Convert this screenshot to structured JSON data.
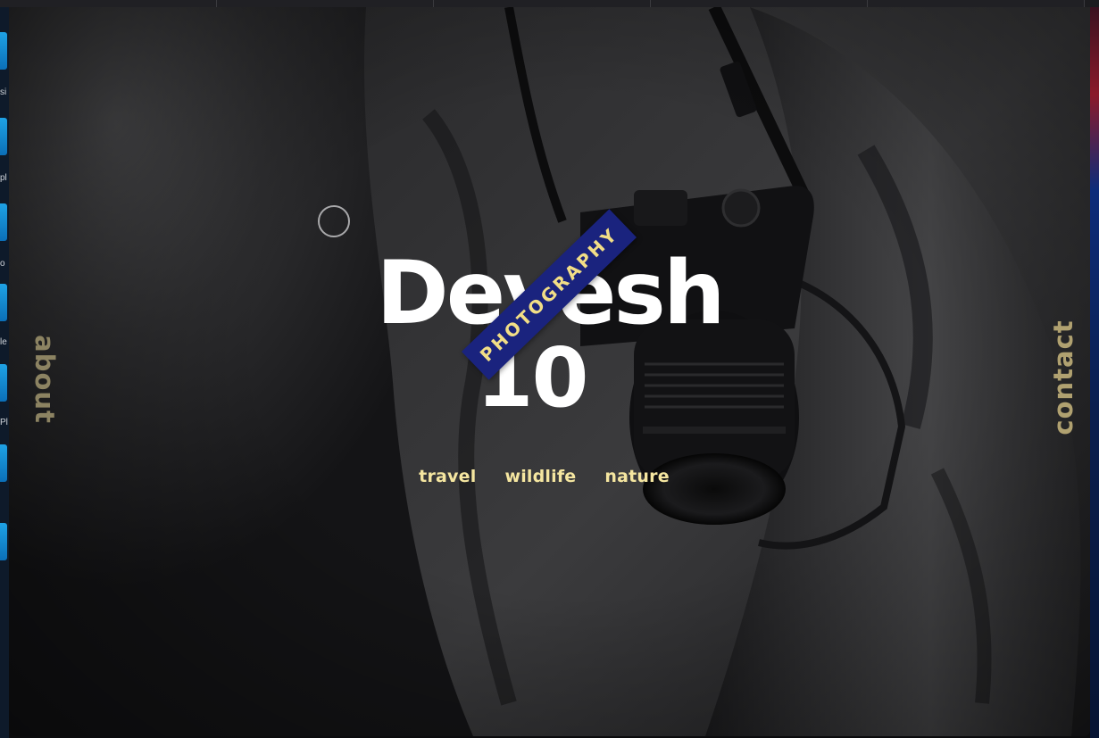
{
  "browser": {
    "tabs": [
      "",
      "",
      "",
      "",
      ""
    ]
  },
  "desktop_left": {
    "labels": [
      "si",
      "pl",
      "o",
      "le",
      "Pl"
    ]
  },
  "nav": {
    "about": "about",
    "contact": "contact"
  },
  "hero": {
    "name": "Devesh",
    "number": "10",
    "badge": "PHOTOGRAPHY",
    "categories": [
      "travel",
      "wildlife",
      "nature"
    ]
  },
  "colors": {
    "accent_yellow": "#f5e6a0",
    "badge_blue": "#1a237e",
    "badge_text": "#f2de86",
    "side_link": "#8c8362"
  }
}
